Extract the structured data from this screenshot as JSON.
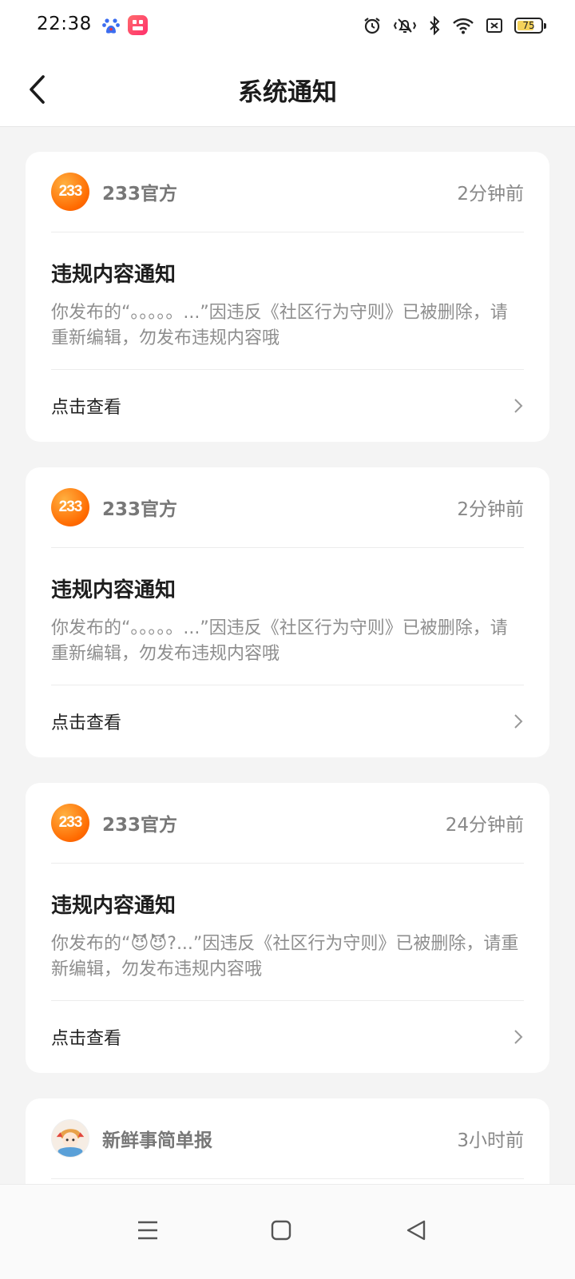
{
  "status_bar": {
    "time": "22:38",
    "battery_level": "75",
    "battery_fraction": 0.75,
    "icons": [
      "baidu-app-icon",
      "app-icon",
      "alarm-icon",
      "vibrate-icon",
      "bluetooth-icon",
      "wifi-icon",
      "sim-icon",
      "battery-icon"
    ]
  },
  "header": {
    "title": "系统通知",
    "back_icon": "back-arrow-icon"
  },
  "notifications": [
    {
      "sender": "233官方",
      "avatar_text": "233",
      "time": "2分钟前",
      "title": "违规内容通知",
      "text": "你发布的“。。。。。...”因违反《社区行为守则》已被删除，请重新编辑，勿发布违规内容哦",
      "action": "点击查看"
    },
    {
      "sender": "233官方",
      "avatar_text": "233",
      "time": "2分钟前",
      "title": "违规内容通知",
      "text": "你发布的“。。。。。...”因违反《社区行为守则》已被删除，请重新编辑，勿发布违规内容哦",
      "action": "点击查看"
    },
    {
      "sender": "233官方",
      "avatar_text": "233",
      "time": "24分钟前",
      "title": "违规内容通知",
      "text": "你发布的“😈😈?...”因违反《社区行为守则》已被删除，请重新编辑，勿发布违规内容哦",
      "action": "点击查看"
    }
  ],
  "partial_notification": {
    "sender": "新鲜事简单报",
    "time": "3小时前"
  },
  "colors": {
    "accent_orange": "#ff6a00",
    "background": "#f4f4f4",
    "card": "#ffffff"
  }
}
